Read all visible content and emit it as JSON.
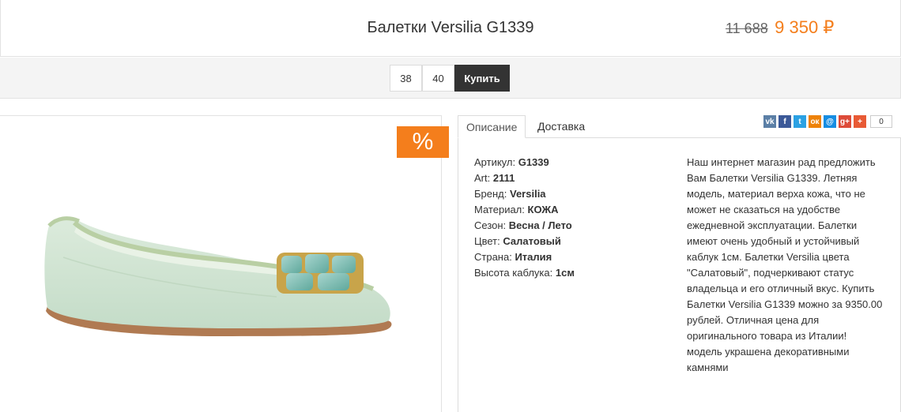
{
  "header": {
    "title": "Балетки Versilia G1339",
    "old_price": "11 688",
    "new_price": "9 350 ₽"
  },
  "sizes": [
    "38",
    "40"
  ],
  "buy_label": "Купить",
  "sale_badge": "%",
  "tabs": [
    {
      "label": "Описание"
    },
    {
      "label": "Доставка"
    }
  ],
  "share": {
    "buttons": [
      {
        "icon": "vk-icon",
        "glyph": "vk",
        "color": "#5b7fa6"
      },
      {
        "icon": "facebook-icon",
        "glyph": "f",
        "color": "#3b5998"
      },
      {
        "icon": "twitter-icon",
        "glyph": "t",
        "color": "#2ba1e3"
      },
      {
        "icon": "odnoklassniki-icon",
        "glyph": "ок",
        "color": "#ee8208"
      },
      {
        "icon": "mailru-icon",
        "glyph": "@",
        "color": "#168de2"
      },
      {
        "icon": "google-plus-icon",
        "glyph": "g+",
        "color": "#dd4b39"
      },
      {
        "icon": "more-icon",
        "glyph": "+",
        "color": "#e85a35"
      }
    ],
    "count": "0"
  },
  "specs": [
    {
      "label": "Артикул:",
      "value": "G1339"
    },
    {
      "label": "Art:",
      "value": "2111"
    },
    {
      "label": "Бренд:",
      "value": "Versilia"
    },
    {
      "label": "Материал:",
      "value": "КОЖА"
    },
    {
      "label": "Сезон:",
      "value": "Весна / Лето"
    },
    {
      "label": "Цвет:",
      "value": "Салатовый"
    },
    {
      "label": "Страна:",
      "value": "Италия"
    },
    {
      "label": "Высота каблука:",
      "value": "1см"
    }
  ],
  "description": "Наш интернет магазин рад предложить Вам Балетки Versilia G1339. Летняя модель, материал верха кожа, что не может не сказаться на удобстве ежедневной эксплуатации. Балетки имеют очень удобный и устойчивый каблук 1см. Балетки Versilia цвета \"Салатовый\", подчеркивают статус владельца и его отличный вкус. Купить Балетки Versilia G1339 можно за 9350.00 рублей. Отличная цена для оригинального товара из Италии! модель украшена декоративными камнями",
  "colors": {
    "accent": "#f47e1c",
    "buy_button": "#333333"
  }
}
